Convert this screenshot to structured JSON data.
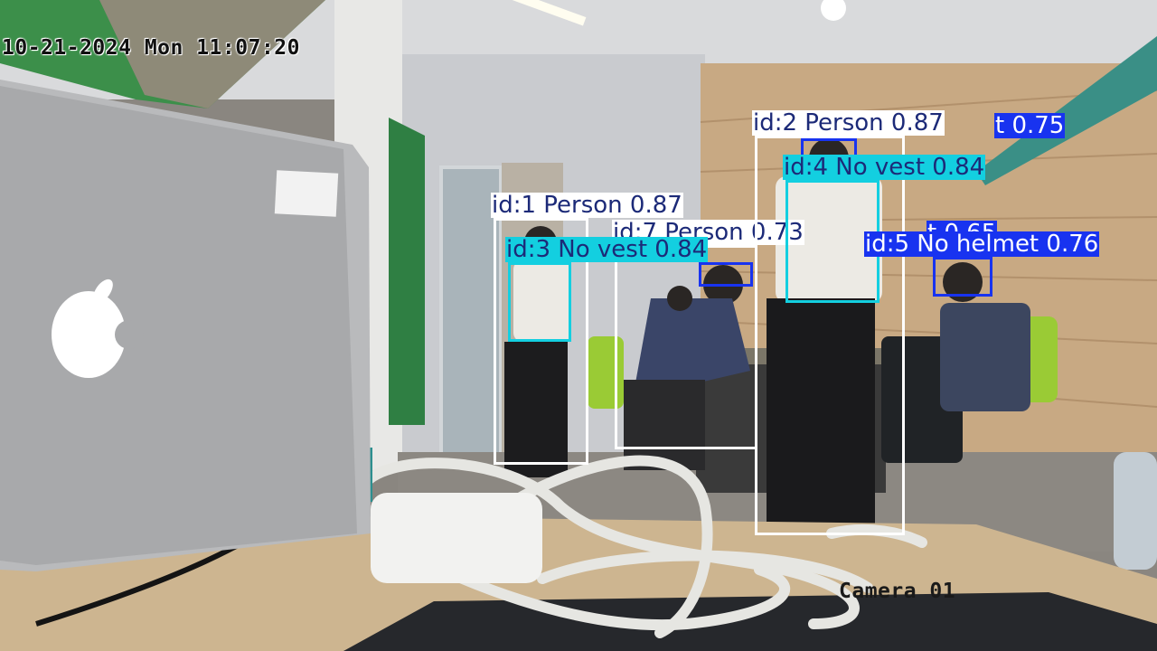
{
  "overlay": {
    "timestamp": "10-21-2024 Mon 11:07:20",
    "camera_label": "Camera 01"
  },
  "detections": [
    {
      "label": "id:1 Person 0.87"
    },
    {
      "label": "id:2 Person 0.87"
    },
    {
      "label": "id:3 No vest 0.84"
    },
    {
      "label": "id:4 No vest 0.84"
    },
    {
      "label": "id:5 No helmet 0.76"
    },
    {
      "label": "id:7 Person 0.73"
    },
    {
      "label": "t 0.75"
    },
    {
      "label": "t 0.65"
    }
  ],
  "colors": {
    "person_box": "#ffffff",
    "vest_box": "#13cfe0",
    "helmet_box": "#1833f0"
  }
}
